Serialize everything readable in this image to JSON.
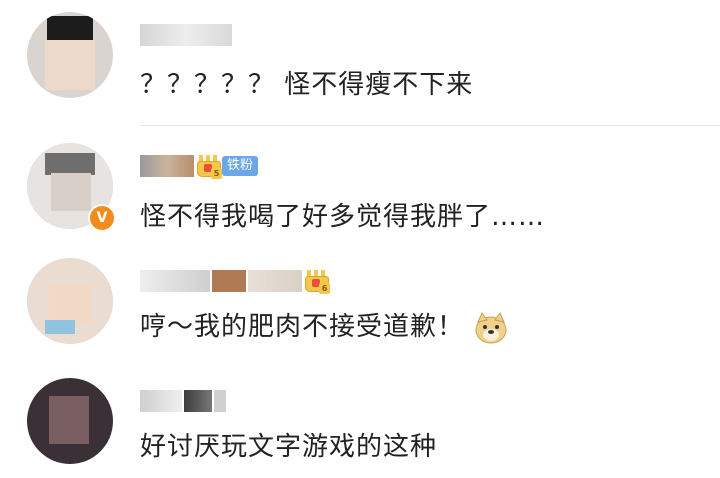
{
  "comments": [
    {
      "text": "？？？？？ 怪不得瘦不下来",
      "verified": false,
      "crown": false,
      "fan_badge": ""
    },
    {
      "text": "怪不得我喝了好多觉得我胖了……",
      "verified": true,
      "verified_label": "V",
      "crown": true,
      "crown_level": "5",
      "fan_badge": "铁粉"
    },
    {
      "text": "哼～我的肥肉不接受道歉！",
      "verified": false,
      "crown": true,
      "crown_level": "6",
      "fan_badge": "",
      "emoji": "doge-icon"
    },
    {
      "text": "好讨厌玩文字游戏的这种",
      "verified": false,
      "crown": false,
      "fan_badge": ""
    }
  ],
  "colors": {
    "fan_badge": "#6aa6e8",
    "verified": "#f28c1c",
    "crown": "#f3c64c"
  }
}
